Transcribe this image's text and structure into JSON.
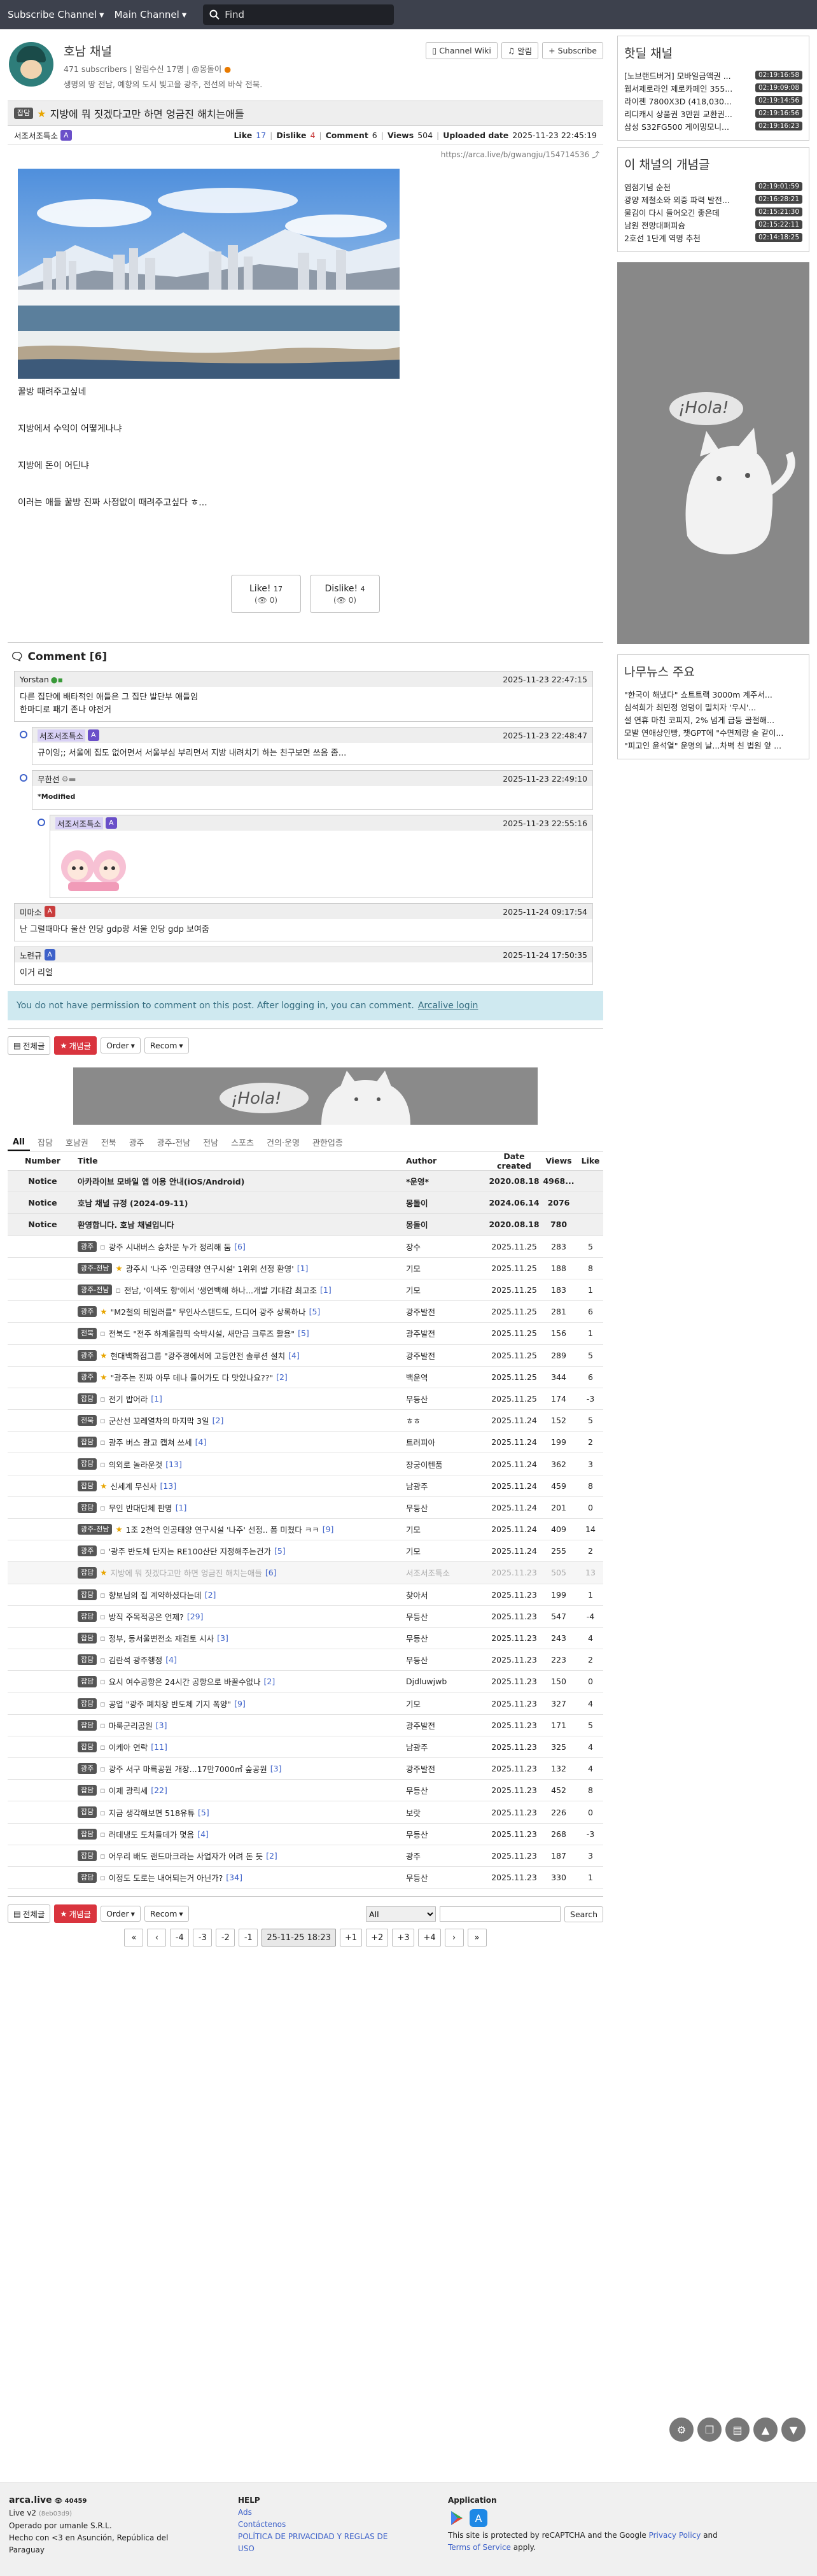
{
  "nav": {
    "subscribe": "Subscribe Channel",
    "main": "Main Channel",
    "search_placeholder": "Find"
  },
  "channel": {
    "name": "호남 채널",
    "subscribers": "471 subscribers",
    "alarm": "알림수신 17명",
    "manager": "@몽돌이",
    "description": "생명의 땅 전남, 예향의 도시 빛고을 광주, 전선의 바삭 전북.",
    "wiki_label": "Channel Wiki",
    "notify_label": "알림",
    "subscribe_label": "Subscribe"
  },
  "article": {
    "category": "잡담",
    "title": "지방에 뭐 짓겠다고만 하면 엉금진 해치는애들",
    "author": "서조서조특소",
    "like_label": "Like",
    "like": "17",
    "dislike_label": "Dislike",
    "dislike": "4",
    "comment_label": "Comment",
    "comments": "6",
    "views_label": "Views",
    "views": "504",
    "upload_label": "Uploaded date",
    "uploaded": "2025-11-23 22:45:19",
    "url": "https://arca.live/b/gwangju/154714536",
    "paragraphs": [
      "꿀방 때려주고싶네",
      "지방에서 수익이 어떻게나냐",
      "지방에 돈이 어딘냐",
      "이러는 애들 꿀방 진짜 사정없이 때려주고싶다 ㅎ..."
    ],
    "like_btn": "Like!",
    "like_btn_count": "17",
    "like_btn_sub": "(👁 0)",
    "dislike_btn": "Dislike!",
    "dislike_btn_count": "4",
    "dislike_btn_sub": "(👁 0)"
  },
  "comments": {
    "header": "Comment [6]",
    "items": [
      {
        "author": "Yorstan",
        "date": "2025-11-23 22:47:15",
        "lines": [
          "다른 집단에 배타적인 애들은 그 집단 발단부 애들임",
          "한마디로 패기 존나 야전거"
        ]
      },
      {
        "author": "서조서조특소",
        "date": "2025-11-23 22:48:47",
        "lines": [
          "규이잉;; 서울에 집도 없어면서 서울부심 부리면서 지방 내려치기 하는 친구보면 쓰음 좀..."
        ]
      },
      {
        "author": "무한선",
        "date": "2025-11-23 22:49:10",
        "lines": [
          "*Modified"
        ]
      },
      {
        "author": "서조서조특소",
        "date": "2025-11-23 22:55:16",
        "lines": [
          ""
        ]
      },
      {
        "author": "미마소",
        "date": "2025-11-24 09:17:54",
        "lines": [
          "난 그럴때마다 울산 인당 gdp랑 서울 인당 gdp 보여줌"
        ]
      },
      {
        "author": "노련규",
        "date": "2025-11-24 17:50:35",
        "lines": [
          "이거 리얼"
        ]
      }
    ],
    "notice": "You do not have permission to comment on this post. After logging in, you can comment.",
    "login": "Arcalive login"
  },
  "listbar": {
    "all": "전체글",
    "best": "개념글",
    "order": "Order",
    "recom": "Recom"
  },
  "ad_text": "¡Hola!",
  "categories": [
    "All",
    "잡담",
    "호남권",
    "전북",
    "광주",
    "광주-전남",
    "전남",
    "스포츠",
    "건의·운영",
    "관한업종"
  ],
  "table": {
    "headers": {
      "number": "Number",
      "title": "Title",
      "author": "Author",
      "date": "Date created",
      "views": "Views",
      "like": "Like"
    },
    "rows": [
      {
        "num": "Notice",
        "badge": "",
        "star": false,
        "title": "아카라이브 모바일 앱 이용 안내(iOS/Android)",
        "cc": "",
        "author": "*운영*",
        "date": "2020.08.18",
        "views": "4968...",
        "like": "",
        "type": "notice"
      },
      {
        "num": "Notice",
        "badge": "",
        "star": false,
        "title": "호남 채널 규정 (2024-09-11)",
        "cc": "",
        "author": "몽돌이",
        "date": "2024.06.14",
        "views": "2076",
        "like": "",
        "type": "notice"
      },
      {
        "num": "Notice",
        "badge": "",
        "star": false,
        "title": "환영합니다. 호남 채널입니다",
        "cc": "",
        "author": "몽돌이",
        "date": "2020.08.18",
        "views": "780",
        "like": "",
        "type": "notice"
      },
      {
        "num": "",
        "badge": "광주",
        "star": false,
        "title": "광주 시내버스 승차문 누가 정리해 둠",
        "cc": "[6]",
        "author": "장수",
        "date": "2025.11.25",
        "views": "283",
        "like": "5",
        "type": ""
      },
      {
        "num": "",
        "badge": "광주-전남",
        "star": true,
        "title": "광주시 '나주 '인공태양 연구시설' 1위위 선정 환영'",
        "cc": "[1]",
        "author": "기모",
        "date": "2025.11.25",
        "views": "188",
        "like": "8",
        "type": ""
      },
      {
        "num": "",
        "badge": "광주-전남",
        "star": false,
        "title": "전남, '이색도 향'에서 '생연백해 하나...개발 기대감 최고조",
        "cc": "[1]",
        "author": "기모",
        "date": "2025.11.25",
        "views": "183",
        "like": "1",
        "type": ""
      },
      {
        "num": "",
        "badge": "광주",
        "star": true,
        "title": "\"M2철의 테일러를\" 무인사스탠드도, 드디어 광주 상록하나",
        "cc": "[5]",
        "author": "광주발전",
        "date": "2025.11.25",
        "views": "281",
        "like": "6",
        "type": ""
      },
      {
        "num": "",
        "badge": "전북",
        "star": false,
        "title": "전북도 \"전주 하계올림픽 숙박시설, 새만금 크루즈 활용\"",
        "cc": "[5]",
        "author": "광주발전",
        "date": "2025.11.25",
        "views": "156",
        "like": "1",
        "type": ""
      },
      {
        "num": "",
        "badge": "광주",
        "star": true,
        "title": "현대백화점그룹 \"광주경에서에 고등안전 솔루션 설치",
        "cc": "[4]",
        "author": "광주발전",
        "date": "2025.11.25",
        "views": "289",
        "like": "5",
        "type": ""
      },
      {
        "num": "",
        "badge": "광주",
        "star": true,
        "title": "\"광주는 진짜 아무 데나 들어가도 다 맛있나요??\"",
        "cc": "[2]",
        "author": "백운역",
        "date": "2025.11.25",
        "views": "344",
        "like": "6",
        "type": ""
      },
      {
        "num": "",
        "badge": "잡담",
        "star": false,
        "title": "전기 밥어라",
        "cc": "[1]",
        "author": "무등산",
        "date": "2025.11.25",
        "views": "174",
        "like": "-3",
        "type": ""
      },
      {
        "num": "",
        "badge": "전북",
        "star": false,
        "title": "군산선 꼬레열차의 마지막 3일",
        "cc": "[2]",
        "author": "ㅎㅎ",
        "date": "2025.11.24",
        "views": "152",
        "like": "5",
        "type": ""
      },
      {
        "num": "",
        "badge": "잡담",
        "star": false,
        "title": "광주 버스 광고 캡쳐 쓰세",
        "cc": "[4]",
        "author": "트러피아",
        "date": "2025.11.24",
        "views": "199",
        "like": "2",
        "type": ""
      },
      {
        "num": "",
        "badge": "잡담",
        "star": false,
        "title": "의외로 놀라운것",
        "cc": "[13]",
        "author": "장궁이텐품",
        "date": "2025.11.24",
        "views": "362",
        "like": "3",
        "type": ""
      },
      {
        "num": "",
        "badge": "잡담",
        "star": true,
        "title": "신세계 무신사",
        "cc": "[13]",
        "author": "남광주",
        "date": "2025.11.24",
        "views": "459",
        "like": "8",
        "type": ""
      },
      {
        "num": "",
        "badge": "잡담",
        "star": false,
        "title": "무인 반대단체 판명",
        "cc": "[1]",
        "author": "무등산",
        "date": "2025.11.24",
        "views": "201",
        "like": "0",
        "type": ""
      },
      {
        "num": "",
        "badge": "광주-전남",
        "star": true,
        "title": "1조 2천억 인공태양 연구시설 '나주' 선정.. 폼 미쳤다 ㅋㅋ",
        "cc": "[9]",
        "author": "기모",
        "date": "2025.11.24",
        "views": "409",
        "like": "14",
        "type": ""
      },
      {
        "num": "",
        "badge": "광주",
        "star": false,
        "title": "'광주 반도체 단지는 RE100산단 지정해주는건가",
        "cc": "[5]",
        "author": "기모",
        "date": "2025.11.24",
        "views": "255",
        "like": "2",
        "type": ""
      },
      {
        "num": "",
        "badge": "잡담",
        "star": true,
        "title": "지방에 뭐 짓겠다고만 하면 엉금진 해치는애들",
        "cc": "[6]",
        "author": "서조서조특소",
        "date": "2025.11.23",
        "views": "505",
        "like": "13",
        "type": "faded"
      },
      {
        "num": "",
        "badge": "잡담",
        "star": false,
        "title": "향보님의 집 계약하셨다는데",
        "cc": "[2]",
        "author": "찾아서",
        "date": "2025.11.23",
        "views": "199",
        "like": "1",
        "type": ""
      },
      {
        "num": "",
        "badge": "잡담",
        "star": false,
        "title": "방직 주목적공은 언제?",
        "cc": "[29]",
        "author": "무등산",
        "date": "2025.11.23",
        "views": "547",
        "like": "-4",
        "type": ""
      },
      {
        "num": "",
        "badge": "잡담",
        "star": false,
        "title": "정부, 동서울변전소 재검토 시사",
        "cc": "[3]",
        "author": "무등산",
        "date": "2025.11.23",
        "views": "243",
        "like": "4",
        "type": ""
      },
      {
        "num": "",
        "badge": "잡담",
        "star": false,
        "title": "김란석 광주행정",
        "cc": "[4]",
        "author": "무등산",
        "date": "2025.11.23",
        "views": "223",
        "like": "2",
        "type": ""
      },
      {
        "num": "",
        "badge": "잡담",
        "star": false,
        "title": "요시 여수공항은 24시간 공항으로 바꿀수없나",
        "cc": "[2]",
        "author": "Djdluwjwb",
        "date": "2025.11.23",
        "views": "150",
        "like": "0",
        "type": ""
      },
      {
        "num": "",
        "badge": "잡담",
        "star": false,
        "title": "공업 \"광주 폐치장 반도체 기지 폭양\"",
        "cc": "[9]",
        "author": "기모",
        "date": "2025.11.23",
        "views": "327",
        "like": "4",
        "type": ""
      },
      {
        "num": "",
        "badge": "잡담",
        "star": false,
        "title": "마룩군리공원",
        "cc": "[3]",
        "author": "광주발전",
        "date": "2025.11.23",
        "views": "171",
        "like": "5",
        "type": ""
      },
      {
        "num": "",
        "badge": "잡담",
        "star": false,
        "title": "이케아 연락",
        "cc": "[11]",
        "author": "남광주",
        "date": "2025.11.23",
        "views": "325",
        "like": "4",
        "type": ""
      },
      {
        "num": "",
        "badge": "광주",
        "star": false,
        "title": "광주 서구 마륵공원 개장...17만7000㎡ 숲공원",
        "cc": "[3]",
        "author": "광주발전",
        "date": "2025.11.23",
        "views": "132",
        "like": "4",
        "type": ""
      },
      {
        "num": "",
        "badge": "잡담",
        "star": false,
        "title": "이제 광릭세",
        "cc": "[22]",
        "author": "무등산",
        "date": "2025.11.23",
        "views": "452",
        "like": "8",
        "type": ""
      },
      {
        "num": "",
        "badge": "잡담",
        "star": false,
        "title": "지금 생각해보면 518유튜",
        "cc": "[5]",
        "author": "보랏",
        "date": "2025.11.23",
        "views": "226",
        "like": "0",
        "type": ""
      },
      {
        "num": "",
        "badge": "잡담",
        "star": false,
        "title": "러데냉도 도처들데가 몇음",
        "cc": "[4]",
        "author": "무등산",
        "date": "2025.11.23",
        "views": "268",
        "like": "-3",
        "type": ""
      },
      {
        "num": "",
        "badge": "잡담",
        "star": false,
        "title": "어우리 배도 랜드마크라는 사업자가 어려 돈 듯",
        "cc": "[2]",
        "author": "광주",
        "date": "2025.11.23",
        "views": "187",
        "like": "3",
        "type": ""
      },
      {
        "num": "",
        "badge": "잡담",
        "star": false,
        "title": "이정도 도로는 내어되는거 아닌가?",
        "cc": "[34]",
        "author": "무등산",
        "date": "2025.11.23",
        "views": "330",
        "like": "1",
        "type": ""
      }
    ]
  },
  "search": {
    "option": "All",
    "button": "Search"
  },
  "pager": [
    "«",
    "‹",
    "-4",
    "-3",
    "-2",
    "-1",
    "25-11-25 18:23",
    "+1",
    "+2",
    "+3",
    "+4",
    "›",
    "»"
  ],
  "sidebar": {
    "hot_title": "핫딜 채널",
    "hot": [
      {
        "t": "[노브랜드버거] 모바일금액권 ...",
        "time": "02:19:16:58"
      },
      {
        "t": "웹서제로라인 제로카페인 355...",
        "time": "02:19:09:08"
      },
      {
        "t": "라이젠 7800X3D (418,030...",
        "time": "02:19:14:56"
      },
      {
        "t": "리디캐시 상품권 3만원 교환권...",
        "time": "02:19:16:56"
      },
      {
        "t": "삼성 S32FG500 게이밍모니...",
        "time": "02:19:16:23"
      }
    ],
    "best_title": "이 채널의 개념글",
    "best": [
      {
        "t": "염첨기념 순천",
        "time": "02:19:01:59"
      },
      {
        "t": "광양 제철소와 외증 파력 발전...",
        "time": "02:16:28:21"
      },
      {
        "t": "물김이 다시 들어오긴 좋은데",
        "time": "02:15:21:30"
      },
      {
        "t": "남원 전망대퍼피슘",
        "time": "02:15:22:11"
      },
      {
        "t": "2호선 1단계 역명 추천",
        "time": "02:14:18:25"
      }
    ],
    "ad_text": "¡Hola!",
    "news_title": "나무뉴스 주요",
    "news": [
      "\"한국이 해냈다\" 쇼트트랙 3000m 계주서...",
      "심석희가 최민정 엉덩이 밀치자 '우시'...",
      "설 연휴 마친 코피지, 2% 넘게 급등 골절해...",
      "모발 연애상인빵, 챗GPT에 \"수면제랑 술 같이...",
      "\"피고인 윤석열\" 운명의 날...차벽 친 법원 앞 ..."
    ]
  },
  "footer": {
    "brand": "arca.live",
    "count": "40459",
    "version": "Live v2",
    "version_hash": "(8eb03d9)",
    "operator": "Operado por umanle S.R.L.",
    "made": "Hecho con <3 en Asunción, República del Paraguay",
    "help_title": "HELP",
    "help_links": [
      "Ads",
      "Contáctenos",
      "POLÍTICA DE PRIVACIDAD Y REGLAS DE USO"
    ],
    "app_title": "Application",
    "recaptcha_pre": "This site is protected by reCAPTCHA and the Google",
    "privacy": "Privacy Policy",
    "and": "and",
    "terms": "Terms of Service",
    "apply": "apply."
  }
}
